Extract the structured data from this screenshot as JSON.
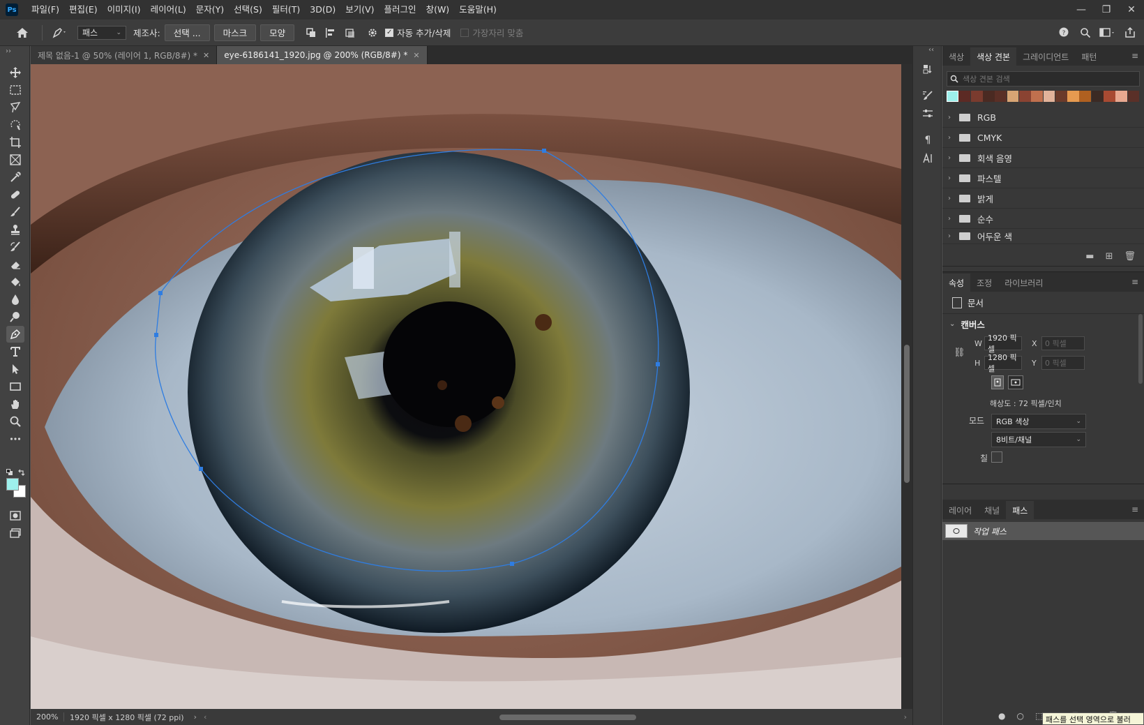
{
  "menubar": {
    "logo": "Ps",
    "items": [
      "파일(F)",
      "편집(E)",
      "이미지(I)",
      "레이어(L)",
      "문자(Y)",
      "선택(S)",
      "필터(T)",
      "3D(D)",
      "보기(V)",
      "플러그인",
      "창(W)",
      "도움말(H)"
    ]
  },
  "options": {
    "mode_select": "패스",
    "make_label": "제조사:",
    "btn_select": "선택 ...",
    "btn_mask": "마스크",
    "btn_shape": "모양",
    "auto_add_label": "자동 추가/삭제",
    "auto_add_checked": true,
    "align_edges_label": "가장자리 맞춤",
    "align_edges_checked": false
  },
  "tabs": [
    {
      "label": "제목 없음-1 @ 50% (레이어 1, RGB/8#) *",
      "active": false
    },
    {
      "label": "eye-6186141_1920.jpg @ 200% (RGB/8#) *",
      "active": true
    }
  ],
  "status": {
    "zoom": "200%",
    "info": "1920 픽셀 x 1280 픽셀 (72 ppi)"
  },
  "swatches_panel": {
    "tabs": [
      "색상",
      "색상 견본",
      "그레이디언트",
      "패턴"
    ],
    "active_tab": "색상 견본",
    "search_placeholder": "색상 견본 검색",
    "recent_colors": [
      "#9ef0ec",
      "#5c2a24",
      "#7a3b2e",
      "#4a2a22",
      "#5a2f26",
      "#d8a574",
      "#8a4332",
      "#c0704e",
      "#e2b39a",
      "#6b3a2a",
      "#e69a50",
      "#b06020",
      "#3b2a24",
      "#a84a32",
      "#e8a890",
      "#5a3028"
    ],
    "folders": [
      "RGB",
      "CMYK",
      "회색 음영",
      "파스텔",
      "밝게",
      "순수",
      "어두운 색"
    ]
  },
  "properties_panel": {
    "tabs": [
      "속성",
      "조정",
      "라이브러리"
    ],
    "active_tab": "속성",
    "doc_label": "문서",
    "section": "캔버스",
    "w_label": "W",
    "w_value": "1920 픽셀",
    "h_label": "H",
    "h_value": "1280 픽셀",
    "x_label": "X",
    "x_placeholder": "0 픽셀",
    "y_label": "Y",
    "y_placeholder": "0 픽셀",
    "resolution": "해상도 : 72 픽셀/인치",
    "mode_label": "모드",
    "mode_value": "RGB 색상",
    "depth_value": "8비트/채널",
    "fill_label": "칠"
  },
  "paths_panel": {
    "tabs": [
      "레이어",
      "채널",
      "패스"
    ],
    "active_tab": "패스",
    "items": [
      "작업 패스"
    ]
  },
  "tooltip": "패스를 선택 영역으로 불러",
  "colors": {
    "foreground": "#9ef0ec",
    "background": "#ffffff",
    "path_stroke": "#2f7de1"
  }
}
